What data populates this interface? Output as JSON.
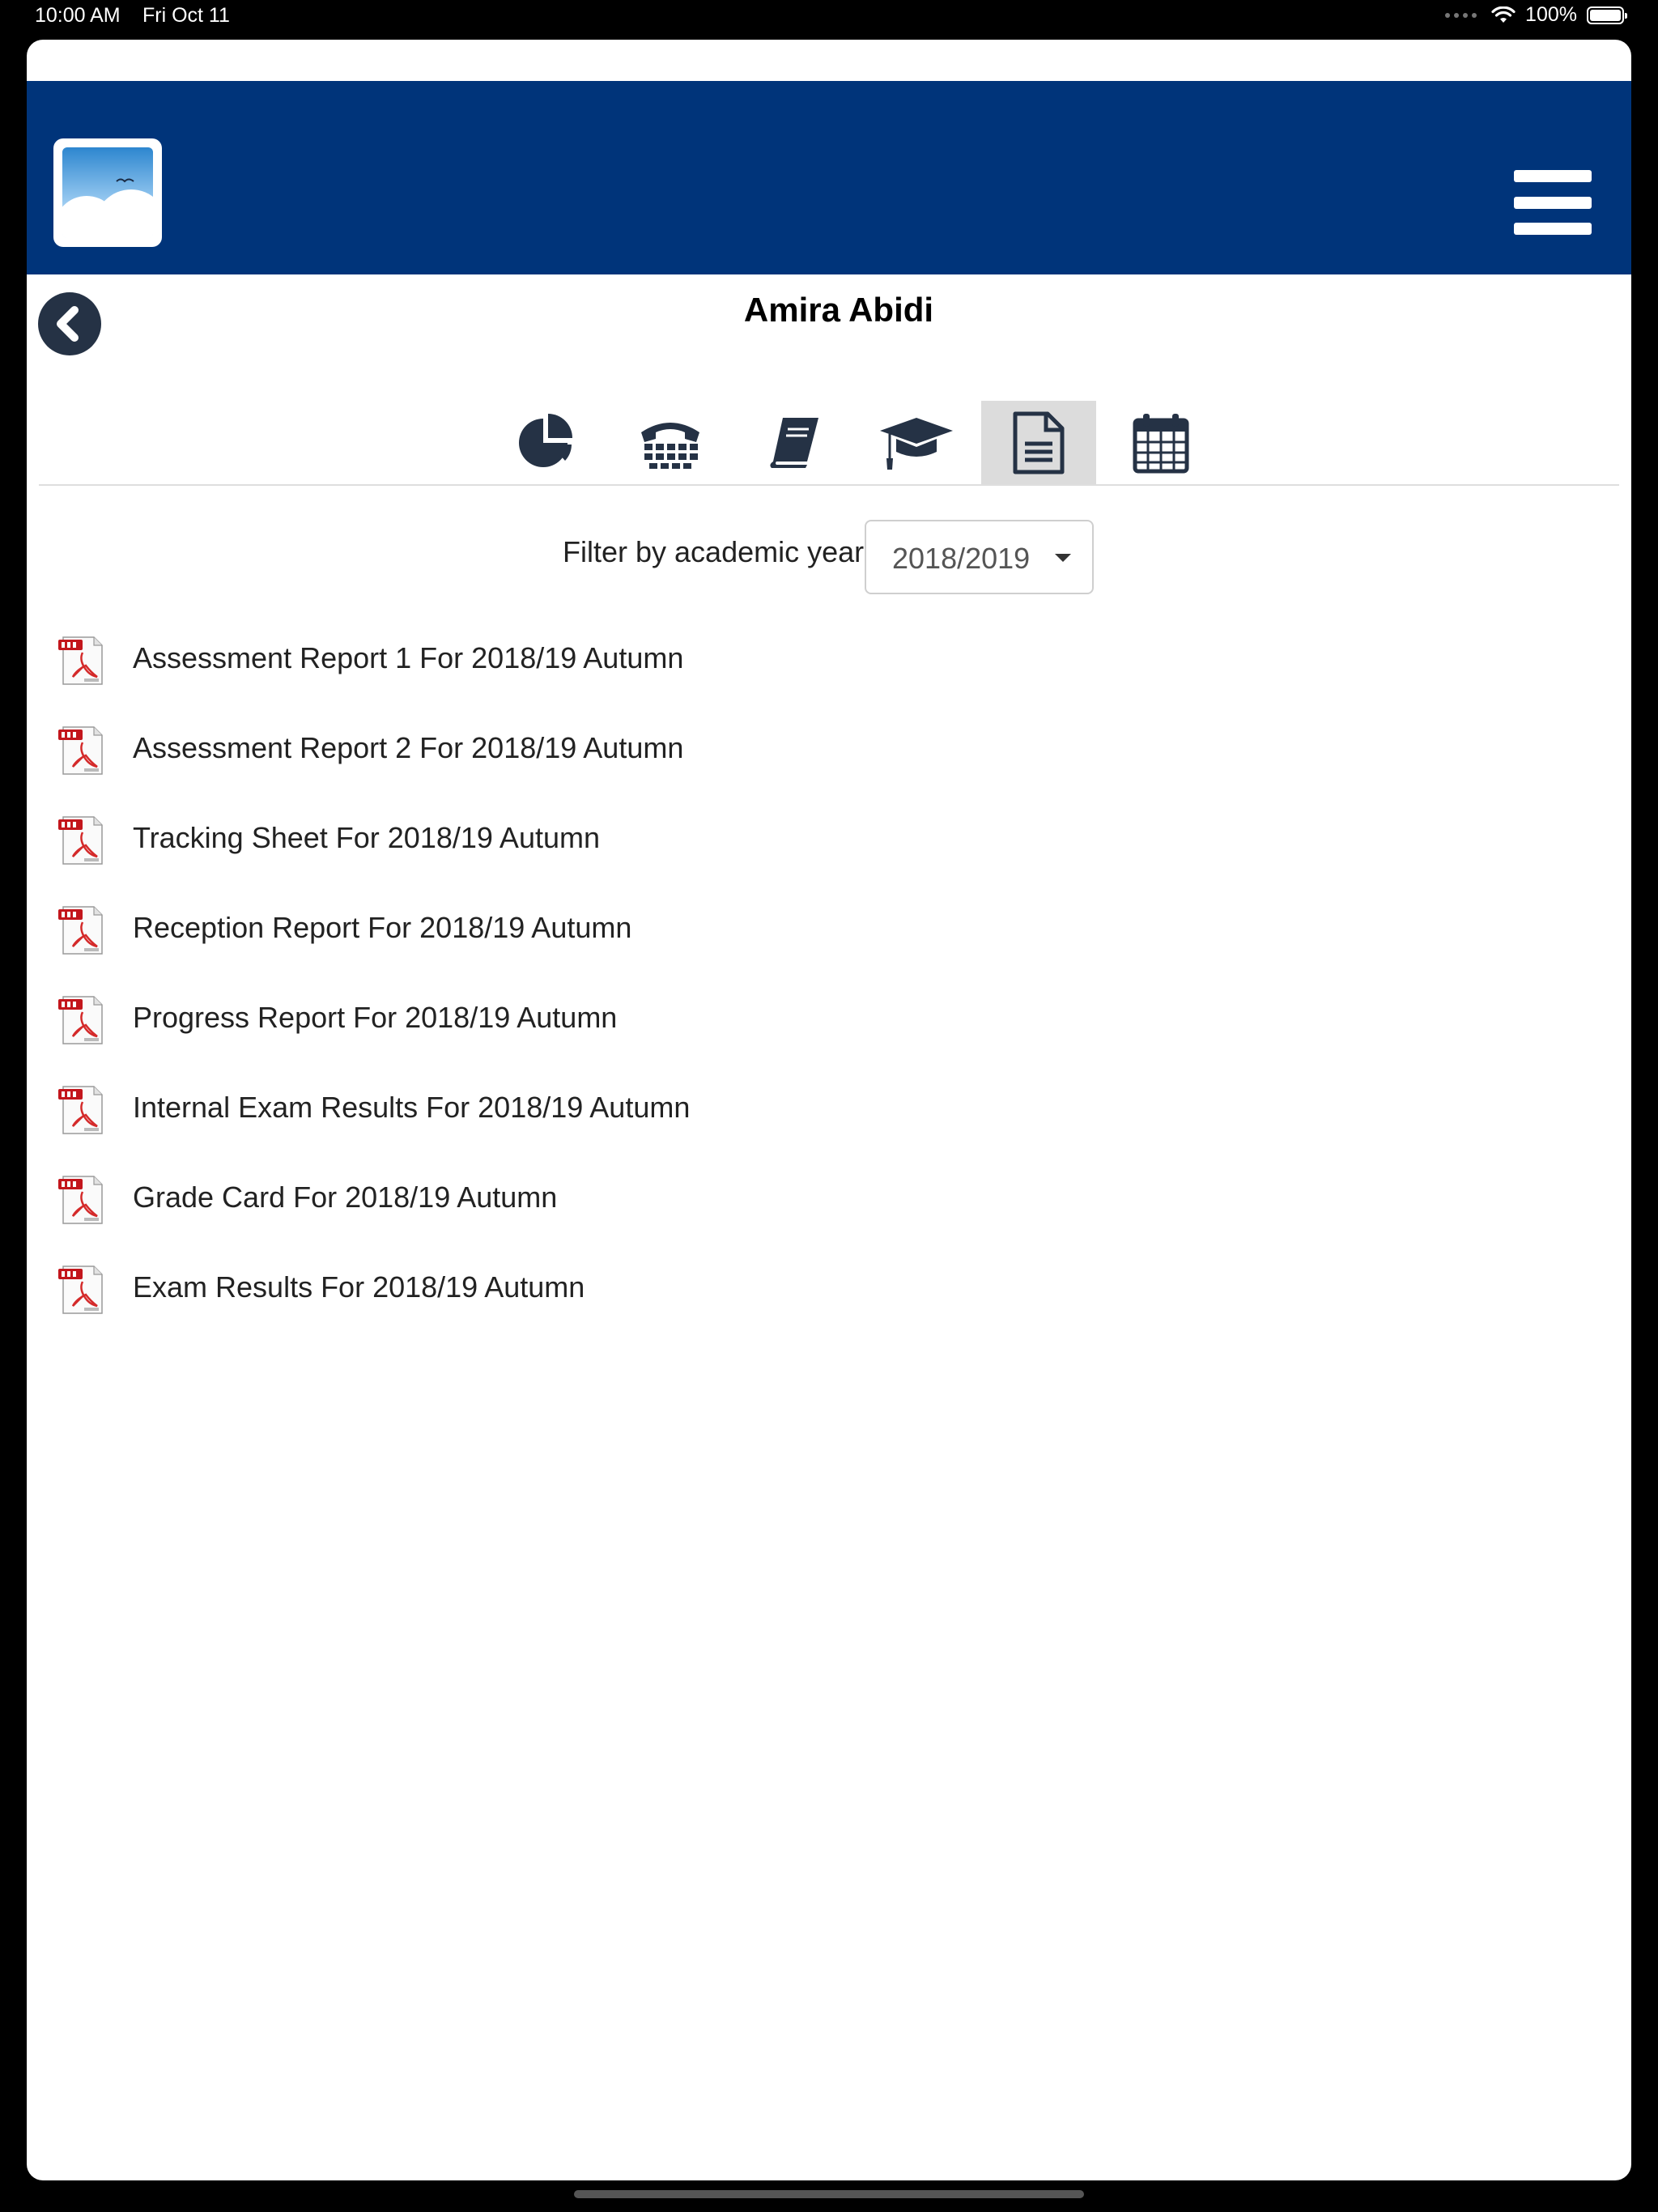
{
  "status_bar": {
    "time": "10:00 AM",
    "date": "Fri Oct 11",
    "battery": "100%"
  },
  "header": {
    "logo_icon": "cloud-sky-logo",
    "menu_icon": "hamburger-icon",
    "brand_color": "#00347a"
  },
  "page": {
    "title": "Amira Abidi",
    "back_icon": "chevron-left-icon"
  },
  "tabs": [
    {
      "icon": "pie-chart-icon",
      "active": false
    },
    {
      "icon": "phone-icon",
      "active": false
    },
    {
      "icon": "book-icon",
      "active": false
    },
    {
      "icon": "graduation-cap-icon",
      "active": false
    },
    {
      "icon": "document-icon",
      "active": true
    },
    {
      "icon": "calendar-icon",
      "active": false
    }
  ],
  "filter": {
    "label": "Filter by academic year",
    "selected": "2018/2019"
  },
  "reports": [
    {
      "label": "Assessment Report 1 For 2018/19 Autumn",
      "icon": "pdf-icon"
    },
    {
      "label": "Assessment Report 2 For 2018/19 Autumn",
      "icon": "pdf-icon"
    },
    {
      "label": "Tracking Sheet For 2018/19 Autumn",
      "icon": "pdf-icon"
    },
    {
      "label": "Reception Report For 2018/19 Autumn",
      "icon": "pdf-icon"
    },
    {
      "label": "Progress Report For 2018/19 Autumn",
      "icon": "pdf-icon"
    },
    {
      "label": "Internal Exam Results For 2018/19 Autumn",
      "icon": "pdf-icon"
    },
    {
      "label": "Grade Card For 2018/19 Autumn",
      "icon": "pdf-icon"
    },
    {
      "label": "Exam Results For 2018/19 Autumn",
      "icon": "pdf-icon"
    }
  ]
}
